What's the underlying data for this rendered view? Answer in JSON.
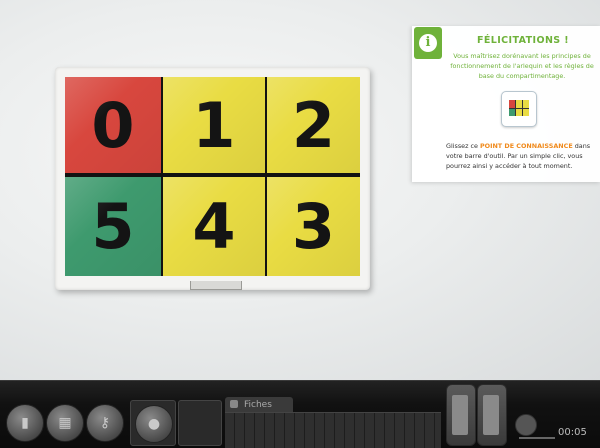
{
  "panel": {
    "top_row": [
      "0",
      "1",
      "2"
    ],
    "bottom_row": [
      "5",
      "4",
      "3"
    ],
    "colors": {
      "red": "#d8473e",
      "yellow": "#e9dc43",
      "green": "#3e9a6e"
    }
  },
  "info": {
    "icon": "info-icon",
    "title": "FÉLICITATIONS !",
    "text1": "Vous maîtrisez dorénavant les principes de fonctionnement de l'arlequin et les règles de base du compartimentage.",
    "text2_before": "Glissez ce ",
    "text2_highlight": "POINT DE CONNAISSANCE",
    "text2_after": " dans votre barre d'outil. Par un simple clic, vous pourrez ainsi y accéder à tout moment.",
    "accent": "#6fb23a",
    "highlight_color": "#f08a1c"
  },
  "toolbar": {
    "fiches_label": "Fiches",
    "timer": "00:05",
    "icons": [
      "binder-icon",
      "box-icon",
      "keys-icon",
      "radio-icon"
    ]
  }
}
